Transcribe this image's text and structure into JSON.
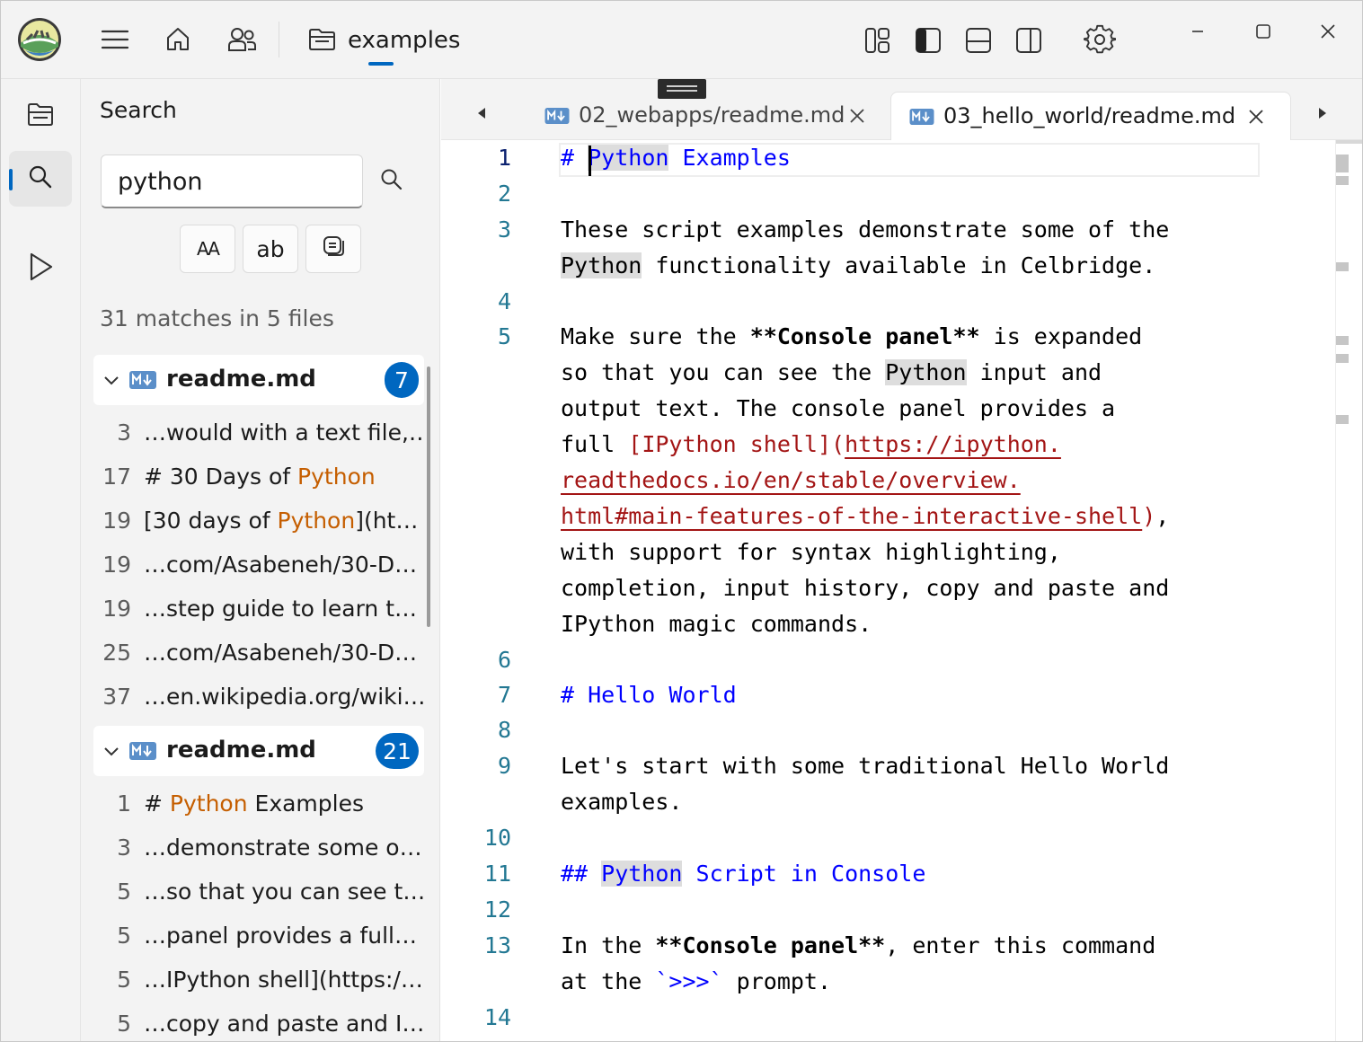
{
  "titlebar": {
    "folder_name": "examples",
    "icons": [
      "app-logo-icon",
      "hamburger-menu-icon",
      "home-icon",
      "people-icon",
      "folder-icon",
      "layout-grid-icon",
      "sidebar-left-icon",
      "panel-bottom-icon",
      "sidebar-right-icon",
      "settings-gear-icon",
      "minimize-icon",
      "maximize-icon",
      "close-icon"
    ]
  },
  "activity_bar": {
    "items": [
      {
        "icon": "explorer-icon",
        "active": false
      },
      {
        "icon": "search-icon",
        "active": true
      },
      {
        "icon": "run-icon",
        "active": false
      }
    ]
  },
  "search_panel": {
    "title": "Search",
    "query": "python",
    "options": {
      "match_case": "AA",
      "whole_word": "ab",
      "regex_icon": "regex-icon"
    },
    "summary": "31 matches in 5 files",
    "groups": [
      {
        "file": "readme.md",
        "count": "7",
        "matches": [
          {
            "line": "3",
            "pre": "…would with a text file,…",
            "hit": "",
            "post": ""
          },
          {
            "line": "17",
            "pre": "# 30 Days of ",
            "hit": "Python",
            "post": ""
          },
          {
            "line": "19",
            "pre": "[30 days of ",
            "hit": "Python",
            "post": "](ht…"
          },
          {
            "line": "19",
            "pre": "…com/Asabeneh/30-D…",
            "hit": "",
            "post": ""
          },
          {
            "line": "19",
            "pre": "…step guide to learn t…",
            "hit": "",
            "post": ""
          },
          {
            "line": "25",
            "pre": "…com/Asabeneh/30-D…",
            "hit": "",
            "post": ""
          },
          {
            "line": "37",
            "pre": "…en.wikipedia.org/wiki…",
            "hit": "",
            "post": ""
          }
        ]
      },
      {
        "file": "readme.md",
        "count": "21",
        "matches": [
          {
            "line": "1",
            "pre": "# ",
            "hit": "Python",
            "post": " Examples"
          },
          {
            "line": "3",
            "pre": "…demonstrate some o…",
            "hit": "",
            "post": ""
          },
          {
            "line": "5",
            "pre": "…so that you can see t…",
            "hit": "",
            "post": ""
          },
          {
            "line": "5",
            "pre": "…panel provides a full…",
            "hit": "",
            "post": ""
          },
          {
            "line": "5",
            "pre": "…IPython shell](https:/…",
            "hit": "",
            "post": ""
          },
          {
            "line": "5",
            "pre": "…copy and paste and I…",
            "hit": "",
            "post": ""
          }
        ]
      }
    ]
  },
  "editor": {
    "tabs": [
      {
        "label": "02_webapps/readme.md",
        "active": false
      },
      {
        "label": "03_hello_world/readme.md",
        "active": true
      }
    ],
    "line_numbers": [
      "1",
      "2",
      "3",
      "4",
      "5",
      "6",
      "7",
      "8",
      "9",
      "10",
      "11",
      "12",
      "13",
      "14"
    ],
    "code": {
      "l1_hash": "# ",
      "l1_python": "Python",
      "l1_rest": " Examples",
      "l3a": "These script examples demonstrate some of the",
      "l3b_python": "Python",
      "l3b_rest": " functionality available in Celbridge.",
      "l5a_pre": "Make sure the ",
      "l5a_bold": "**Console panel**",
      "l5a_post": " is expanded",
      "l5b_pre": "so that you can see the ",
      "l5b_python": "Python",
      "l5b_post": " input and",
      "l5c": "output text. The console panel provides a",
      "l5d_pre": "full ",
      "l5d_bracket": "[IPython shell](",
      "l5d_url": "https://ipython.",
      "l5e_url": "readthedocs.io/en/stable/overview.",
      "l5f_url": "html#main-features-of-the-interactive-shell",
      "l5f_close": ")",
      "l5f_post": ",",
      "l5g": "with support for syntax highlighting,",
      "l5h": "completion, input history, copy and paste and",
      "l5i": "IPython magic commands.",
      "l7": "# Hello World",
      "l9a": "Let's start with some traditional Hello World",
      "l9b": "examples.",
      "l11_hash": "## ",
      "l11_python": "Python",
      "l11_rest": " Script in Console",
      "l13a_pre": "In the ",
      "l13a_bold": "**Console panel**",
      "l13a_post": ", enter this command",
      "l13b_pre": "at the ",
      "l13b_code": "`>>>`",
      "l13b_post": " prompt."
    }
  },
  "colors": {
    "accent": "#0067c0",
    "match_highlight_text": "#c55e00",
    "heading_blue": "#0000ff",
    "link_red": "#a31515",
    "line_number": "#237893"
  }
}
